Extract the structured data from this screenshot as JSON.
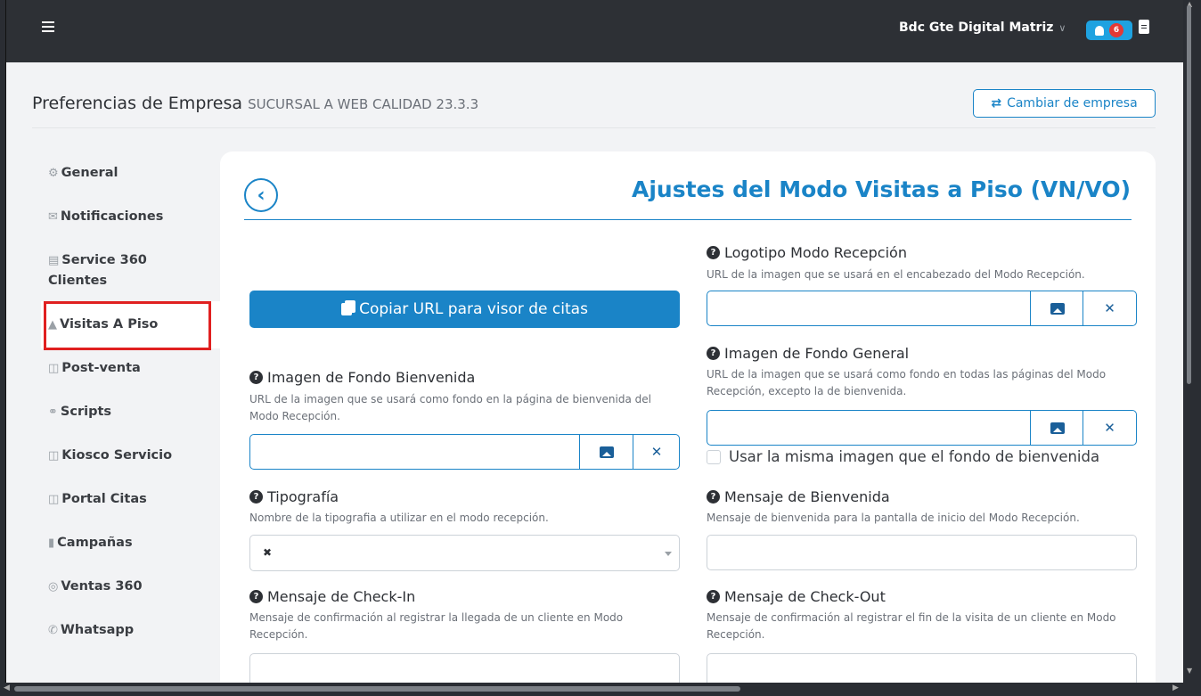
{
  "topbar": {
    "user_name": "Bdc Gte Digital Matriz",
    "notification_count": "6"
  },
  "page": {
    "title": "Preferencias de Empresa",
    "subtitle": "SUCURSAL A WEB CALIDAD 23.3.3",
    "switch_company_label": "Cambiar de empresa"
  },
  "sidebar": {
    "items": [
      {
        "label": "General",
        "icon": "gears-icon"
      },
      {
        "label": "Notificaciones",
        "icon": "envelope-icon"
      },
      {
        "label": "Service 360",
        "label2": "Clientes",
        "icon": "store-icon"
      },
      {
        "label": "Visitas A Piso",
        "icon": "concierge-bell-icon",
        "active": true
      },
      {
        "label": "Post-venta",
        "icon": "car-side-icon"
      },
      {
        "label": "Scripts",
        "icon": "headset-icon"
      },
      {
        "label": "Kiosco Servicio",
        "icon": "car-icon"
      },
      {
        "label": "Portal Citas",
        "icon": "car-icon"
      },
      {
        "label": "Campañas",
        "icon": "file-icon"
      },
      {
        "label": "Ventas 360",
        "icon": "target-icon"
      },
      {
        "label": "Whatsapp",
        "icon": "whatsapp-icon"
      }
    ]
  },
  "panel": {
    "title": "Ajustes del Modo Visitas a Piso (VN/VO)",
    "copy_url_label": "Copiar URL para visor de citas",
    "fields": {
      "logo": {
        "label": "Logotipo Modo Recepción",
        "help": "URL de la imagen que se usará en el encabezado del Modo Recepción.",
        "value": ""
      },
      "bg_general": {
        "label": "Imagen de Fondo General",
        "help": "URL de la imagen que se usará como fondo en todas las páginas del Modo Recepción, excepto la de bienvenida.",
        "value": ""
      },
      "same_image_checkbox": {
        "label": "Usar la misma imagen que el fondo de bienvenida",
        "checked": false
      },
      "bg_welcome": {
        "label": "Imagen de Fondo Bienvenida",
        "help": "URL de la imagen que se usará como fondo en la página de bienvenida del Modo Recepción.",
        "value": ""
      },
      "typography": {
        "label": "Tipografía",
        "help": "Nombre de la tipografia a utilizar en el modo recepción.",
        "value": ""
      },
      "welcome_msg": {
        "label": "Mensaje de Bienvenida",
        "help": "Mensaje de bienvenida para la pantalla de inicio del Modo Recepción.",
        "value": ""
      },
      "checkin_msg": {
        "label": "Mensaje de Check-In",
        "help": "Mensaje de confirmación al registrar la llegada de un cliente en Modo Recepción.",
        "value": ""
      },
      "checkout_msg": {
        "label": "Mensaje de Check-Out",
        "help": "Mensaje de confirmación al registrar el fin de la visita de un cliente en Modo Recepción.",
        "value": ""
      }
    }
  },
  "colors": {
    "accent": "#1a84c7",
    "topbar": "#2d3035",
    "highlight": "#e02020",
    "badge": "#e53935"
  }
}
